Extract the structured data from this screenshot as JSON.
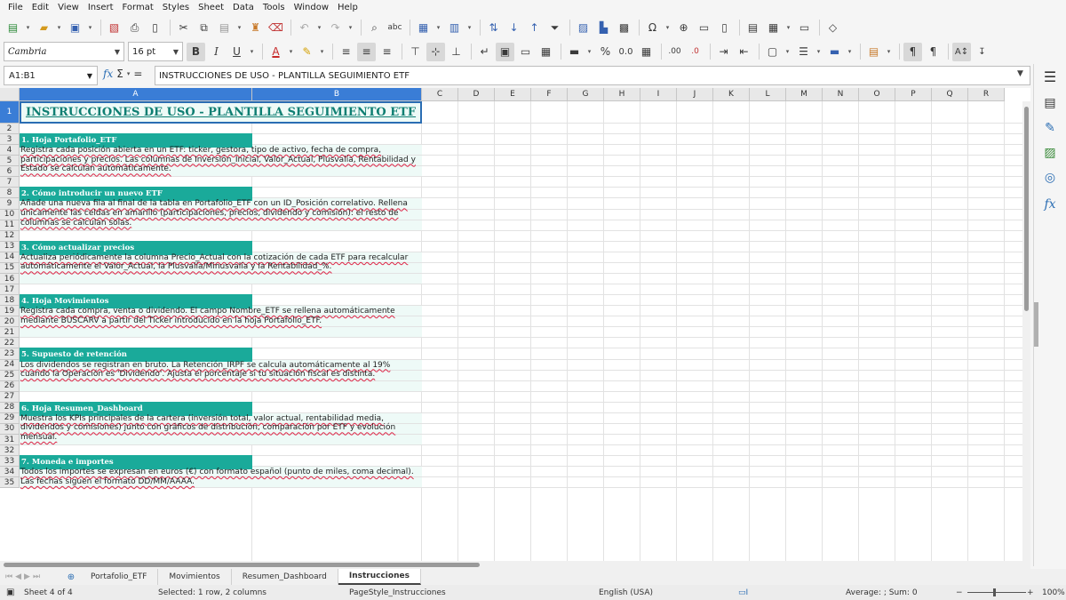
{
  "menu": [
    "File",
    "Edit",
    "View",
    "Insert",
    "Format",
    "Styles",
    "Sheet",
    "Data",
    "Tools",
    "Window",
    "Help"
  ],
  "font": {
    "name": "Cambria",
    "size": "16 pt"
  },
  "namebox": "A1:B1",
  "formula": "INSTRUCCIONES DE USO - PLANTILLA SEGUIMIENTO ETF",
  "columns": [
    "A",
    "B",
    "C",
    "D",
    "E",
    "F",
    "G",
    "H",
    "I",
    "J",
    "K",
    "L",
    "M",
    "N",
    "O",
    "P",
    "Q",
    "R"
  ],
  "rows": [
    "1",
    "2",
    "3",
    "4",
    "5",
    "6",
    "7",
    "8",
    "9",
    "10",
    "11",
    "12",
    "13",
    "14",
    "15",
    "16",
    "17",
    "18",
    "19",
    "20",
    "21",
    "22",
    "23",
    "24",
    "25",
    "26",
    "27",
    "28",
    "29",
    "30",
    "31",
    "32",
    "33",
    "34",
    "35"
  ],
  "title": "INSTRUCCIONES DE USO - PLANTILLA SEGUIMIENTO ETF",
  "sections": [
    {
      "header": "1. Hoja Portafolio_ETF",
      "body": "Registra cada posición abierta en un ETF: ticker, gestora, tipo de activo, fecha de compra, participaciones y precios. Las columnas de Inversión_Inicial, Valor_Actual, Plusvalía, Rentabilidad y Estado se calculan automáticamente."
    },
    {
      "header": "2. Cómo introducir un nuevo ETF",
      "body": "Añade una nueva fila al final de la tabla en Portafolio_ETF con un ID_Posición correlativo. Rellena únicamente las celdas en amarillo (participaciones, precios, dividendo y comisión): el resto de columnas se calculan solas."
    },
    {
      "header": "3. Cómo actualizar precios",
      "body": "Actualiza periódicamente la columna Precio_Actual con la cotización de cada ETF para recalcular automáticamente el Valor_Actual, la Plusvalía/Minusvalía y la Rentabilidad_%."
    },
    {
      "header": "4. Hoja Movimientos",
      "body": "Registra cada compra, venta o dividendo. El campo Nombre_ETF se rellena automáticamente mediante BUSCARV a partir del Ticker introducido en la hoja Portafolio_ETF."
    },
    {
      "header": "5. Supuesto de retención",
      "body": "Los dividendos se registran en bruto. La Retención_IRPF se calcula automáticamente al 19% cuando la Operación es 'Dividendo'. Ajusta el porcentaje si tu situación fiscal es distinta."
    },
    {
      "header": "6. Hoja Resumen_Dashboard",
      "body": "Muestra los KPIs principales de la cartera (inversión total, valor actual, rentabilidad media, dividendos y comisiones) junto con gráficos de distribución, comparación por ETF y evolución mensual."
    },
    {
      "header": "7. Moneda e importes",
      "body": "Todos los importes se expresan en euros (€) con formato español (punto de miles, coma decimal). Las fechas siguen el formato DD/MM/AAAA."
    }
  ],
  "tabs": [
    "Portafolio_ETF",
    "Movimientos",
    "Resumen_Dashboard",
    "Instrucciones"
  ],
  "active_tab": "Instrucciones",
  "status": {
    "sheet": "Sheet 4 of 4",
    "selection": "Selected: 1 row, 2 columns",
    "pagestyle": "PageStyle_Instrucciones",
    "language": "English (USA)",
    "summary": "Average: ; Sum: 0",
    "zoom": "100%"
  }
}
